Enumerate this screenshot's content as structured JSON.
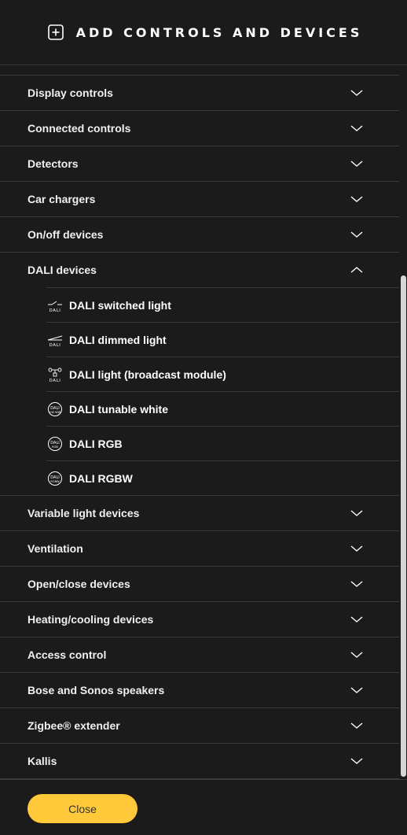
{
  "header": {
    "title": "ADD CONTROLS AND DEVICES",
    "icon": "plus-square-icon"
  },
  "categories_before": [
    {
      "label": "Display controls",
      "expanded": false
    },
    {
      "label": "Connected controls",
      "expanded": false
    },
    {
      "label": "Detectors",
      "expanded": false
    },
    {
      "label": "Car chargers",
      "expanded": false
    },
    {
      "label": "On/off devices",
      "expanded": false
    }
  ],
  "dali": {
    "label": "DALI devices",
    "expanded": true,
    "items": [
      {
        "label": "DALI switched light",
        "icon": "dali-switch-icon"
      },
      {
        "label": "DALI dimmed light",
        "icon": "dali-dimmer-icon"
      },
      {
        "label": "DALI light (broadcast module)",
        "icon": "dali-broadcast-icon"
      },
      {
        "label": "DALI tunable white",
        "icon": "dali-cw-ww-icon",
        "icon_text": "CW WW"
      },
      {
        "label": "DALI RGB",
        "icon": "dali-rgb-icon",
        "icon_text": "RGB"
      },
      {
        "label": "DALI RGBW",
        "icon": "dali-rgbw-icon",
        "icon_text": "RGBW"
      }
    ]
  },
  "categories_after": [
    {
      "label": "Variable light devices",
      "expanded": false
    },
    {
      "label": "Ventilation",
      "expanded": false
    },
    {
      "label": "Open/close devices",
      "expanded": false
    },
    {
      "label": "Heating/cooling devices",
      "expanded": false
    },
    {
      "label": "Access control",
      "expanded": false
    },
    {
      "label": "Bose and Sonos speakers",
      "expanded": false
    },
    {
      "label": "Zigbee® extender",
      "expanded": false
    },
    {
      "label": "Kallis",
      "expanded": false
    }
  ],
  "footer": {
    "close_label": "Close"
  },
  "colors": {
    "background": "#1b1b1b",
    "divider": "#3a3a3a",
    "accent": "#ffc93a",
    "scrollbar": "#d6d6d6"
  }
}
